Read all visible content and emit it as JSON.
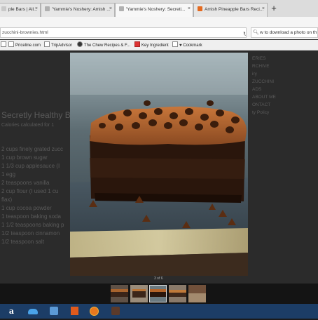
{
  "tabs": [
    {
      "label": "ple Bars | All..."
    },
    {
      "label": "'Yammie's Noshery: Amish ..."
    },
    {
      "label": "'Yammie's Noshery: Secreti..."
    },
    {
      "label": "Amish Pineapple Bars Reci..."
    }
  ],
  "new_tab_label": "+",
  "address": {
    "value": "zucchini-brownies.html"
  },
  "search": {
    "value": "w to download a photo on th"
  },
  "bookmarks": [
    {
      "label": "Priceline.com"
    },
    {
      "label": "TripAdvisor"
    },
    {
      "label": "The Chew Recipes & F..."
    },
    {
      "label": "Key Ingredient"
    },
    {
      "label": "♥ Cookmark"
    }
  ],
  "background_page": {
    "heading": "Secretly Healthy B",
    "subheading": "Calories calculated for 1",
    "ingredients": [
      "2 cups finely grated zucc",
      "1 cup brown sugar",
      "1 1/3 cup applesauce (I",
      "1 egg",
      "2 teaspoons vanilla",
      "2 cup flour (I used 1 cu",
      "flax)",
      "1 cup cocoa powder",
      "1 teaspoon baking soda",
      "1 1/2 teaspoons baking p",
      "1/2 teaspoon cinnamon",
      "1/2 teaspoon salt"
    ],
    "sidebar": [
      "ERIES",
      "RCHIVE",
      "iry",
      "ZUCCHINI",
      "ADS",
      "ABOUT ME",
      "ONTACT",
      "ty Policy"
    ]
  },
  "lightbox": {
    "counter": "3 of 6"
  },
  "thumbnails": [
    {
      "selected": false
    },
    {
      "selected": false
    },
    {
      "selected": true
    },
    {
      "selected": false
    },
    {
      "selected": false
    }
  ],
  "taskbar": [
    {
      "icon": "amazon-icon"
    },
    {
      "icon": "onedrive-icon"
    },
    {
      "icon": "app-store-icon"
    },
    {
      "icon": "office-icon"
    },
    {
      "icon": "firefox-icon"
    },
    {
      "icon": "media-player-icon"
    }
  ],
  "colors": {
    "taskbar": "#1c3d66",
    "frosting": "#b5652a",
    "cake": "#2a160c",
    "slate": "#3f4c56"
  }
}
